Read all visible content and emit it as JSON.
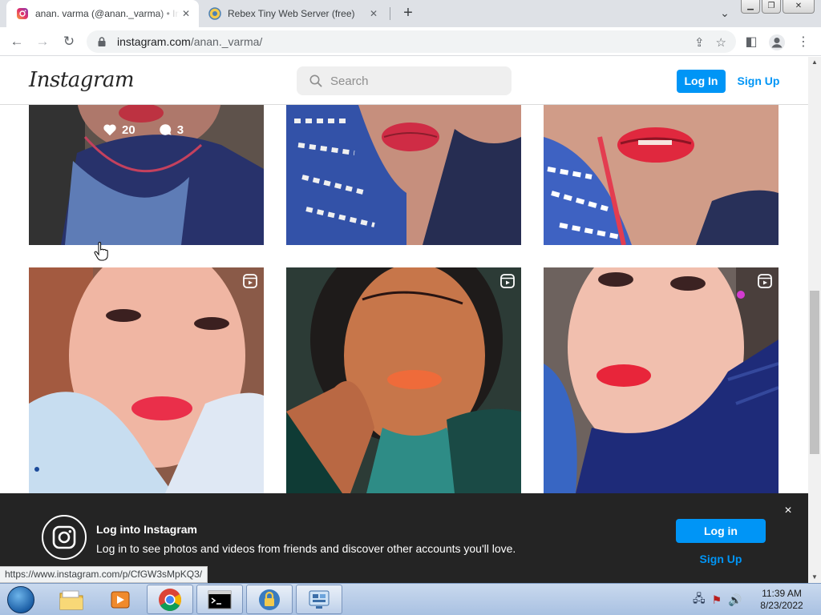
{
  "browser": {
    "tabs": [
      {
        "title": "anan. varma (@anan._varma) • Instagram",
        "active": true
      },
      {
        "title": "Rebex Tiny Web Server (free)",
        "active": false
      }
    ],
    "new_tab_symbol": "+",
    "address": {
      "host": "instagram.com",
      "path": "/anan._varma/"
    },
    "status_url": "https://www.instagram.com/p/CfGW3sMpKQ3/"
  },
  "header": {
    "logo": "Instagram",
    "search_placeholder": "Search",
    "login_label": "Log In",
    "signup_label": "Sign Up"
  },
  "posts": [
    {
      "likes": "20",
      "comments": "3",
      "hover": true,
      "reel": false
    },
    {
      "hover": false,
      "reel": false
    },
    {
      "hover": false,
      "reel": false
    },
    {
      "hover": false,
      "reel": true
    },
    {
      "hover": false,
      "reel": true
    },
    {
      "hover": false,
      "reel": true
    }
  ],
  "banner": {
    "title": "Log into Instagram",
    "text": "Log in to see photos and videos from friends and discover other accounts you'll love.",
    "login_label": "Log in",
    "signup_label": "Sign Up",
    "close_symbol": "×"
  },
  "taskbar": {
    "time": "11:39 AM",
    "date": "8/23/2022"
  },
  "colors": {
    "accent": "#0095f6",
    "banner_bg": "#000000"
  }
}
